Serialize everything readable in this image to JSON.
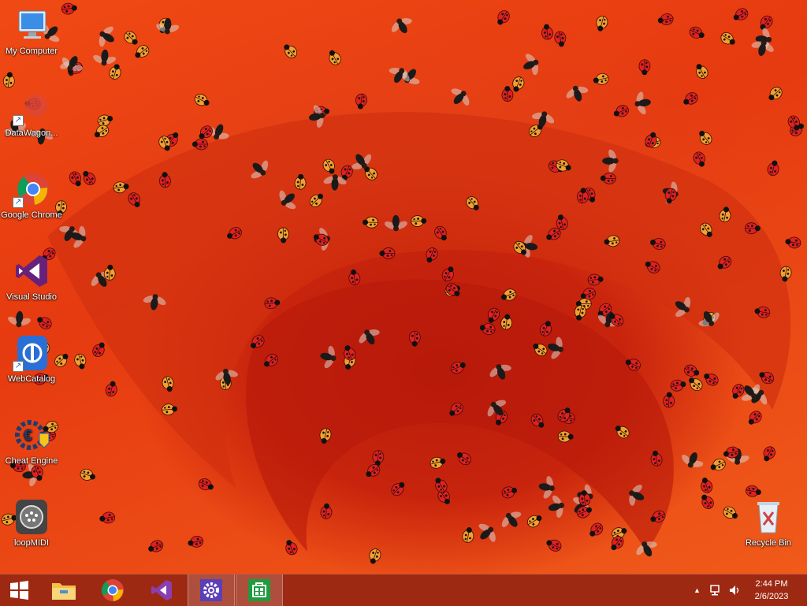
{
  "desktop": {
    "icons": [
      {
        "label": "My Computer",
        "icon": "computer-icon"
      },
      {
        "label": "DataWagon...",
        "icon": "datawagon-icon"
      },
      {
        "label": "Google Chrome",
        "icon": "chrome-icon"
      },
      {
        "label": "Visual Studio",
        "icon": "visual-studio-icon"
      },
      {
        "label": "WebCatalog",
        "icon": "webcatalog-icon"
      },
      {
        "label": "Cheat Engine",
        "icon": "cheat-engine-icon"
      },
      {
        "label": "loopMIDI",
        "icon": "loopmidi-icon"
      },
      {
        "label": "Recycle Bin",
        "icon": "recycle-bin-icon"
      }
    ]
  },
  "taskbar": {
    "pinned": [
      {
        "name": "start",
        "icon": "windows-logo-icon"
      },
      {
        "name": "file-explorer",
        "icon": "folder-icon"
      },
      {
        "name": "chrome",
        "icon": "chrome-icon"
      },
      {
        "name": "visual-studio",
        "icon": "visual-studio-icon"
      },
      {
        "name": "settings",
        "icon": "gear-icon"
      },
      {
        "name": "store",
        "icon": "store-icon"
      }
    ],
    "tray": {
      "show_hidden": "▲",
      "time": "2:44 PM",
      "date": "2/6/2023"
    }
  },
  "colors": {
    "wallpaper": "#e8380f",
    "taskbar": "#96281a",
    "ladybug": "#e02020",
    "orange_ladybug": "#f0a030",
    "fly": "#1a1a1a"
  }
}
